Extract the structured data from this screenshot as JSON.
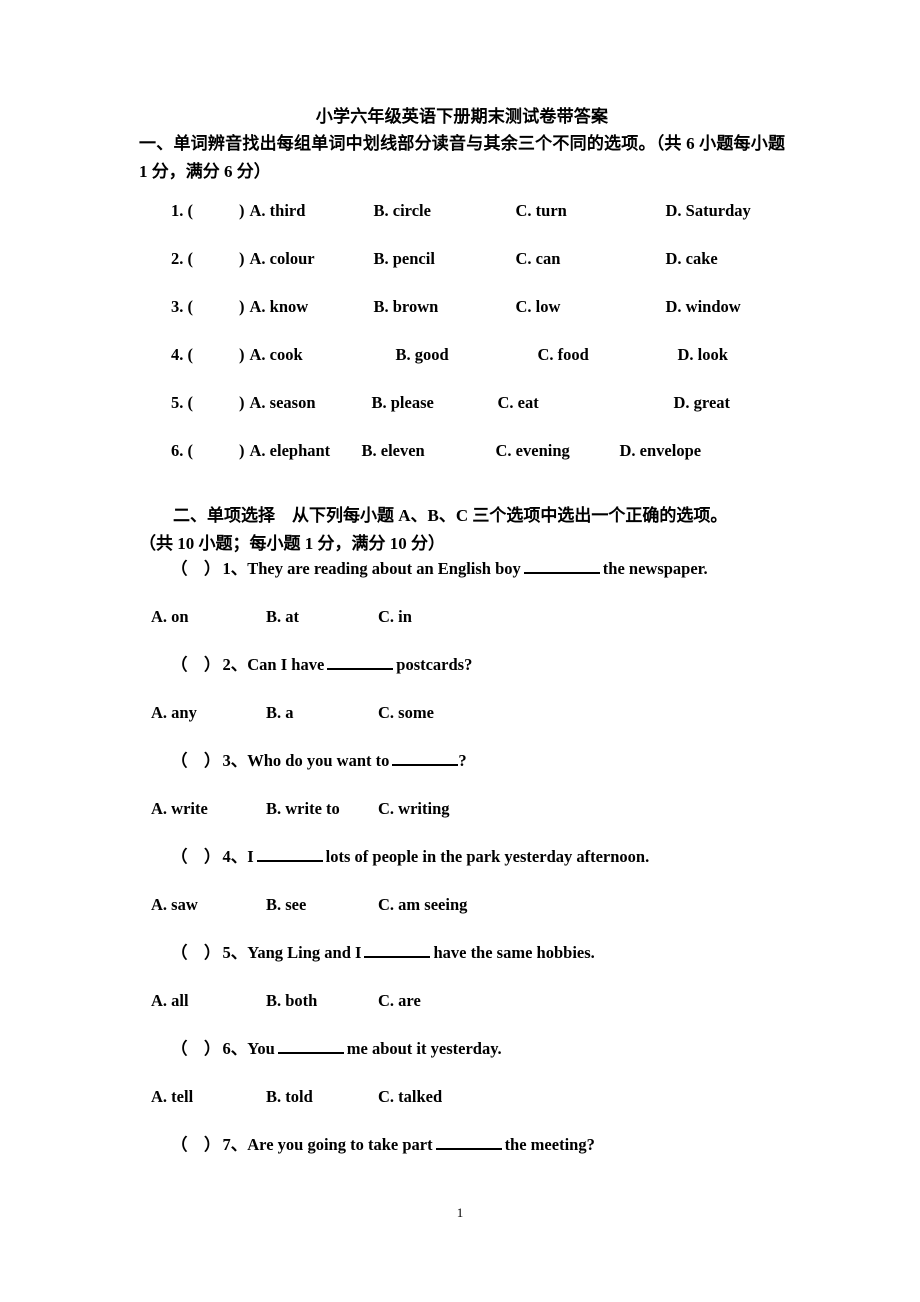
{
  "document": {
    "title": "小学六年级英语下册期末测试卷带答案",
    "page_number": "1"
  },
  "section_one": {
    "heading": "一、单词辨音找出每组单词中划线部分读音与其余三个不同的选项。（共 6 小题每小题 1 分，满分 6 分）",
    "items": [
      {
        "number": "1. (",
        "close": ")",
        "a": "A. third",
        "b": "B. circle",
        "c": "C. turn",
        "d": "D. Saturday"
      },
      {
        "number": "2. (",
        "close": ")",
        "a": "A. colour",
        "b": "B. pencil",
        "c": "C. can",
        "d": "D. cake"
      },
      {
        "number": "3. (",
        "close": ")",
        "a": "A. know",
        "b": "B. brown",
        "c": "C. low",
        "d": "D. window"
      },
      {
        "number": "4. (",
        "close": ")",
        "a": "A. cook",
        "b": "B. good",
        "c": "C. food",
        "d": "D. look"
      },
      {
        "number": "5. (",
        "close": ")",
        "a": "A. season",
        "b": "B. please",
        "c": "C. eat",
        "d": "D. great"
      },
      {
        "number": "6. (",
        "close": ")",
        "a": "A. elephant",
        "b": "B. eleven",
        "c": "C. evening",
        "d": "D. envelope"
      }
    ]
  },
  "section_two": {
    "heading_line1": "二、单项选择　从下列每小题 A、B、C 三个选项中选出一个正确的选项。",
    "heading_line2": "（共 10 小题；每小题 1 分，满分 10 分）",
    "questions": [
      {
        "bracket": "（　）",
        "number": "1、",
        "text_before": "They are reading about an English boy",
        "text_after": "the newspaper.",
        "options": [
          "A. on",
          "B. at",
          "C. in"
        ]
      },
      {
        "bracket": "（　）",
        "number": "2、",
        "text_before": "Can I have",
        "text_after": "postcards?",
        "options": [
          "A. any",
          "B. a",
          "C. some"
        ]
      },
      {
        "bracket": "（　）",
        "number": "3、",
        "text_before": "Who do you want to",
        "text_after": "?",
        "options": [
          "A. write",
          "B. write to",
          "C. writing"
        ]
      },
      {
        "bracket": "（　）",
        "number": "4、",
        "text_before": "I",
        "text_after": "lots of people in the park yesterday afternoon.",
        "options": [
          "A. saw",
          "B. see",
          "C. am seeing"
        ]
      },
      {
        "bracket": "（　）",
        "number": "5、",
        "text_before": "Yang Ling and I",
        "text_after": "have the same hobbies.",
        "options": [
          "A. all",
          "B. both",
          "C. are"
        ]
      },
      {
        "bracket": "（　）",
        "number": "6、",
        "text_before": "You",
        "text_after": "me about it yesterday.",
        "options": [
          "A. tell",
          "B. told",
          "C. talked"
        ]
      },
      {
        "bracket": "（　）",
        "number": "7、",
        "text_before": "Are you going to take part",
        "text_after": "the meeting?",
        "options": []
      }
    ]
  }
}
